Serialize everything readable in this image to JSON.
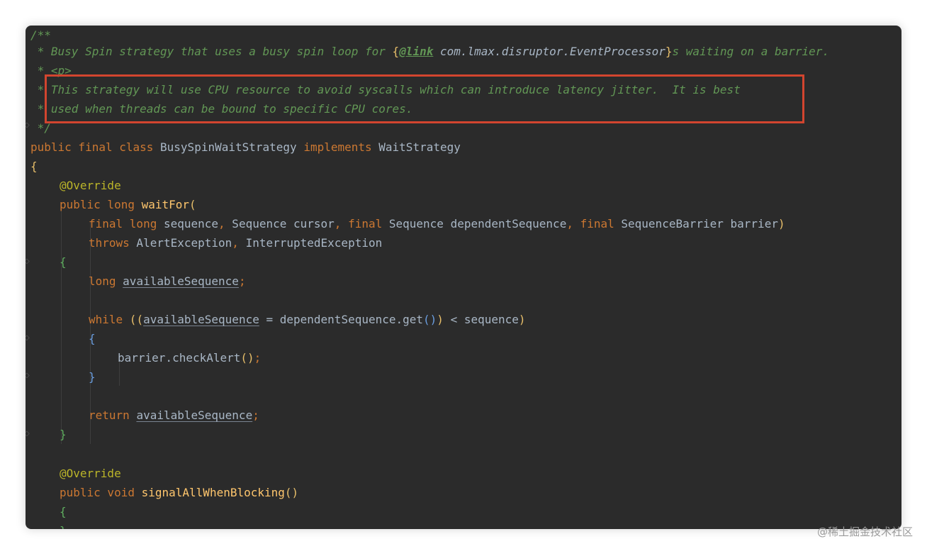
{
  "code": {
    "l1": "/**",
    "l2_pre": " * Busy Spin strategy that uses a busy spin loop for ",
    "l2_brace_open": "{",
    "l2_link_tag": "@link",
    "l2_link_target": " com.lmax.disruptor.EventProcessor",
    "l2_brace_close": "}",
    "l2_post": "s waiting on a barrier.",
    "l3": " * <p>",
    "l4_star": " * ",
    "l4_text": "This strategy will use CPU resource to avoid syscalls which can introduce latency jitter.  It is best",
    "l5_star": " * ",
    "l5_text": "used when threads can be bound to specific CPU cores.",
    "l6": " */",
    "l7_kw": "public final class",
    "l7_name": " BusySpinWaitStrategy ",
    "l7_impl": "implements",
    "l7_iface": " WaitStrategy",
    "l8": "{",
    "l9": "@Override",
    "l10_kw": "public long",
    "l10_fn": "waitFor",
    "l10_paren": "(",
    "l11_final1": "final long",
    "l11_seq": " sequence",
    "l11_comma1": ",",
    "l11_cursor": " Sequence cursor",
    "l11_comma2": ",",
    "l11_final2": " final",
    "l11_dep": " Sequence dependentSequence",
    "l11_comma3": ",",
    "l11_final3": " final",
    "l11_barrier": " SequenceBarrier barrier",
    "l11_close": ")",
    "l12_throws": "throws",
    "l12_exc1": " AlertException",
    "l12_comma": ",",
    "l12_exc2": " InterruptedException",
    "l13": "{",
    "l14_long": "long",
    "l14_var": "availableSequence",
    "l14_semi": ";",
    "l15_while": "while",
    "l15_po": " ((",
    "l15_var": "availableSequence",
    "l15_mid": " = dependentSequence.get",
    "l15_call": "()",
    "l15_close1": ")",
    "l15_cmp": " < sequence",
    "l15_close2": ")",
    "l16": "{",
    "l17_call": "barrier.checkAlert",
    "l17_parens": "()",
    "l17_semi": ";",
    "l18": "}",
    "l19_ret": "return",
    "l19_var": "availableSequence",
    "l19_semi": ";",
    "l20": "}",
    "l21": "@Override",
    "l22_kw": "public void",
    "l22_fn": "signalAllWhenBlocking",
    "l22_parens": "()",
    "l23": "{",
    "l24": "}"
  },
  "colors": {
    "background": "#2b2b2b",
    "highlight_border": "#d2452f",
    "doc_comment": "#629755",
    "keyword": "#cc7832",
    "annotation": "#bbb529",
    "method": "#ffc66d"
  },
  "watermark": "@稀土掘金技术社区"
}
